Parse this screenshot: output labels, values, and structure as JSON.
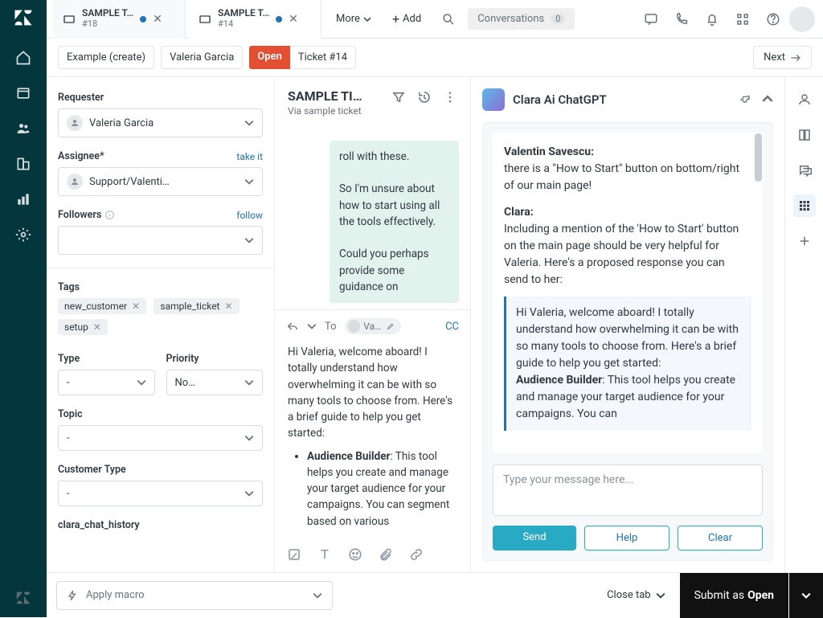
{
  "tabs": [
    {
      "title": "SAMPLE T…",
      "sub": "#18"
    },
    {
      "title": "SAMPLE T…",
      "sub": "#14"
    }
  ],
  "topbar": {
    "more": "More",
    "add": "Add",
    "conversations": "Conversations",
    "conv_count": "0"
  },
  "crumbs": {
    "example": "Example (create)",
    "person": "Valeria Garcia",
    "status": "Open",
    "ticket": "Ticket #14",
    "next": "Next"
  },
  "props": {
    "requester_label": "Requester",
    "requester_value": "Valeria Garcia",
    "assignee_label": "Assignee*",
    "assignee_link": "take it",
    "assignee_value": "Support/Valenti…",
    "followers_label": "Followers",
    "followers_link": "follow",
    "tags_label": "Tags",
    "tags": [
      "new_customer",
      "sample_ticket",
      "setup"
    ],
    "type_label": "Type",
    "type_value": "-",
    "priority_label": "Priority",
    "priority_value": "No…",
    "topic_label": "Topic",
    "topic_value": "-",
    "custtype_label": "Customer Type",
    "custtype_value": "-",
    "history_label": "clara_chat_history"
  },
  "center": {
    "title": "SAMPLE TI…",
    "sub": "Via sample ticket",
    "bubble": "roll with these.\n\nSo I'm unsure about how to start using all the tools effectively.\n\nCould you perhaps provide some guidance on",
    "to_label": "To",
    "to_chip": "Val…",
    "cc": "CC",
    "reply_intro": "Hi Valeria, welcome aboard! I totally understand how overwhelming it can be with so many tools to choose from. Here's a brief guide to help you get started:",
    "reply_bullet_label": "Audience Builder",
    "reply_bullet_text": ": This tool helps you create and manage your target audience for your campaigns. You can segment based on various"
  },
  "clara": {
    "title": "Clara Ai ChatGPT",
    "speaker1": "Valentin Savescu:",
    "line1": "there is a \"How to Start\" button on bottom/right of our main page!",
    "speaker2": "Clara:",
    "line2": "Including a mention of the 'How to Start' button on the main page should be very helpful for Valeria. Here's a proposed response you can send to her:",
    "quote_p1": "Hi Valeria, welcome aboard! I totally understand how overwhelming it can be with so many tools to choose from. Here's a brief guide to help you get started:",
    "quote_b_label": "Audience Builder",
    "quote_b_text": ": This tool helps you create and manage your target audience for your campaigns. You can",
    "placeholder": "Type your message here...",
    "send": "Send",
    "help": "Help",
    "clear": "Clear"
  },
  "bottom": {
    "macro": "Apply macro",
    "close": "Close tab",
    "submit_pre": "Submit as ",
    "submit_status": "Open"
  }
}
